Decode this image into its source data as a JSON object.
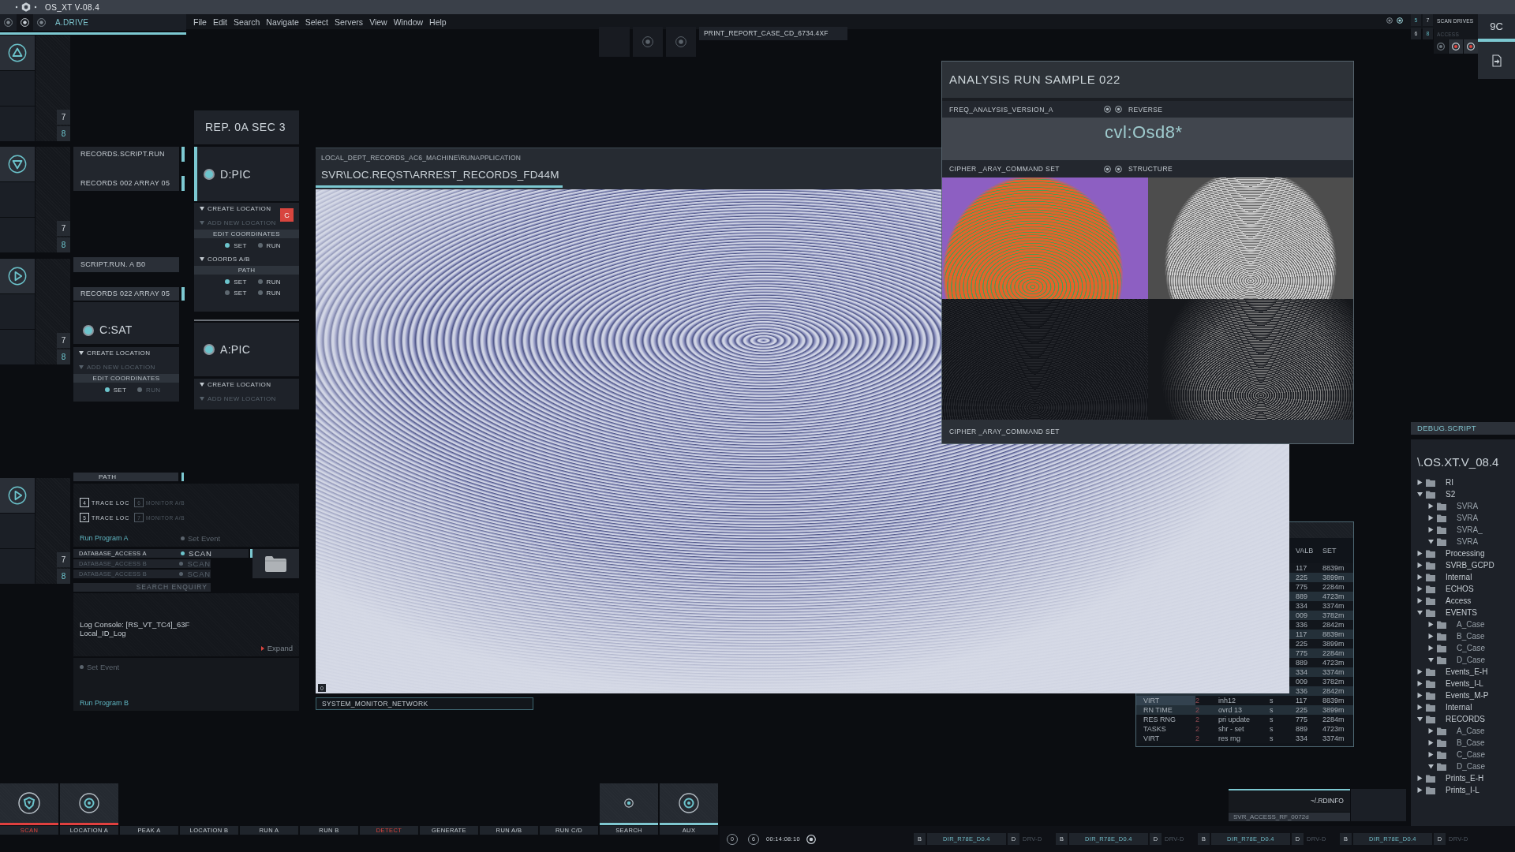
{
  "title_bar": {
    "title": "OS_XT V-08.4"
  },
  "menu_bar": {
    "drive_tab": "A.DRIVE",
    "menus": [
      "File",
      "Edit",
      "Search",
      "Navigate",
      "Select",
      "Servers",
      "View",
      "Window",
      "Help"
    ]
  },
  "top_right": {
    "rows": [
      {
        "numbers": [
          {
            "label": "5",
            "highlighted": true
          },
          {
            "label": "7",
            "highlighted": false
          }
        ],
        "label": "SCAN DRIVES",
        "enabled": true
      },
      {
        "numbers": [
          {
            "label": "6",
            "highlighted": false
          },
          {
            "label": "8",
            "highlighted": true
          }
        ],
        "label": "ACCESS",
        "enabled": false
      }
    ],
    "code": "9C"
  },
  "toolbar": {
    "report": "PRINT_REPORT_CASE_CD_6734.4XF"
  },
  "left_rail": [
    {
      "kind": "up",
      "numbers": [
        {
          "label": "7",
          "highlighted": false
        },
        {
          "label": "8",
          "highlighted": true
        }
      ]
    },
    {
      "kind": "down",
      "numbers": [
        {
          "label": "7",
          "highlighted": false
        },
        {
          "label": "8",
          "highlighted": true
        }
      ]
    },
    {
      "kind": "play",
      "numbers": [
        {
          "label": "7",
          "highlighted": false
        },
        {
          "label": "8",
          "highlighted": true
        }
      ]
    },
    {
      "kind": "play",
      "numbers": [
        {
          "label": "7",
          "highlighted": false
        },
        {
          "label": "8",
          "highlighted": true
        }
      ]
    }
  ],
  "column_a": {
    "scripts": [
      {
        "label": "RECORDS.SCRIPT.RUN",
        "active": true
      },
      {
        "label": "RECORDS 002 ARRAY 05",
        "active": true
      }
    ],
    "tags": [
      {
        "label": "SCRIPT.RUN. A B0",
        "active": false
      },
      {
        "label": "RECORDS 022 ARRAY 05",
        "active": true
      }
    ],
    "drive": {
      "name": "C:SAT",
      "active": false,
      "sections": [
        {
          "kind": "expander",
          "label": "CREATE LOCATION",
          "enabled": true
        },
        {
          "kind": "expander",
          "label": "ADD NEW LOCATION",
          "enabled": false
        },
        {
          "kind": "header",
          "label": "EDIT COORDINATES"
        },
        {
          "kind": "options",
          "options": [
            {
              "label": "SET",
              "on": true,
              "enabled": true
            },
            {
              "label": "RUN",
              "on": false,
              "enabled": false
            }
          ]
        }
      ]
    }
  },
  "column_b": {
    "section_title": "REP. 0A SEC 3",
    "drives": [
      {
        "name": "D:PIC",
        "active": true,
        "sections": [
          {
            "kind": "expander",
            "label": "CREATE LOCATION",
            "enabled": true,
            "tag": "C"
          },
          {
            "kind": "expander",
            "label": "ADD NEW LOCATION",
            "enabled": false
          },
          {
            "kind": "header",
            "label": "EDIT COORDINATES"
          },
          {
            "kind": "options",
            "options": [
              {
                "label": "SET",
                "on": true,
                "enabled": true
              },
              {
                "label": "RUN",
                "on": false,
                "enabled": true
              }
            ]
          },
          {
            "kind": "expander",
            "label": "COORDS A/B",
            "enabled": true
          },
          {
            "kind": "header",
            "label": "PATH"
          },
          {
            "kind": "options",
            "options": [
              {
                "label": "SET",
                "on": true,
                "enabled": true
              },
              {
                "label": "RUN",
                "on": false,
                "enabled": true
              }
            ]
          },
          {
            "kind": "options",
            "options": [
              {
                "label": "SET",
                "on": false,
                "enabled": true
              },
              {
                "label": "RUN",
                "on": false,
                "enabled": true
              }
            ]
          }
        ]
      },
      {
        "name": "A:PIC",
        "active": false,
        "sections": [
          {
            "kind": "expander",
            "label": "CREATE LOCATION",
            "enabled": true
          },
          {
            "kind": "expander",
            "label": "ADD NEW LOCATION",
            "enabled": false
          }
        ]
      }
    ]
  },
  "path_panel": {
    "title": "PATH",
    "active": true,
    "traces": [
      {
        "number": "4",
        "label": "TRACE LOC",
        "enabled": true
      },
      {
        "number": "6",
        "label": "MONITOR A/B",
        "enabled": false
      },
      {
        "number": "5",
        "label": "TRACE LOC",
        "enabled": true
      },
      {
        "number": "7",
        "label": "MONITOR A/B",
        "enabled": false
      }
    ],
    "program": "Run Program A",
    "event": {
      "label": "Set Event",
      "on": false
    }
  },
  "databases": [
    {
      "name": "DATABASE_ACCESS A",
      "action": "SCAN",
      "enabled": true,
      "active": true
    },
    {
      "name": "DATABASE_ACCESS B",
      "action": "SCAN",
      "enabled": false,
      "active": false
    },
    {
      "name": "DATABASE_ACCESS B",
      "action": "SCAN",
      "enabled": false,
      "active": false
    }
  ],
  "search_enquiry": "SEARCH ENQUIRY",
  "log_console": {
    "lines": [
      "Log Console: [RS_VT_TC4]_63F",
      "Local_ID_Log"
    ],
    "expand": "Expand"
  },
  "event_panel": {
    "event": {
      "label": "Set Event",
      "on": false
    },
    "program": "Run Program B"
  },
  "record_window": {
    "path": "LOCAL_DEPT_RECORDS_AC6_MACHINE\\RUNAPPLICATION",
    "title": "SVR\\LOC.REQST\\ARREST_RECORDS_FD44M",
    "corner_label": "0",
    "status": "SYSTEM_MONITOR_NETWORK"
  },
  "analysis_panel": {
    "title": "ANALYSIS RUN SAMPLE 022",
    "freq": {
      "label": "FREQ_ANALYSIS_VERSION_A",
      "option": "REVERSE"
    },
    "value": "cvl:Osd8*",
    "cipher": {
      "label": "CIPHER _ARAY_COMMAND SET",
      "option": "STRUCTURE"
    },
    "images": [
      {
        "kind": "heatmap"
      },
      {
        "kind": "contour"
      },
      {
        "kind": "boxes"
      },
      {
        "kind": "minutiae"
      }
    ],
    "footer": "CIPHER _ARAY_COMMAND SET"
  },
  "process_table": {
    "headers": [
      "VALB",
      "SET"
    ],
    "rows": [
      {
        "valb": "117",
        "set": "8839m",
        "highlighted": false
      },
      {
        "valb": "225",
        "set": "3899m",
        "highlighted": true
      },
      {
        "valb": "775",
        "set": "2284m",
        "highlighted": false
      },
      {
        "valb": "889",
        "set": "4723m",
        "highlighted": true
      },
      {
        "valb": "334",
        "set": "3374m",
        "highlighted": false
      },
      {
        "valb": "009",
        "set": "3782m",
        "highlighted": true
      },
      {
        "valb": "336",
        "set": "2842m",
        "highlighted": false
      },
      {
        "valb": "117",
        "set": "8839m",
        "highlighted": true
      },
      {
        "valb": "225",
        "set": "3899m",
        "highlighted": false
      },
      {
        "valb": "775",
        "set": "2284m",
        "highlighted": true
      },
      {
        "valb": "889",
        "set": "4723m",
        "highlighted": false
      },
      {
        "valb": "334",
        "set": "3374m",
        "highlighted": true
      },
      {
        "valb": "009",
        "set": "3782m",
        "highlighted": false
      },
      {
        "valb": "336",
        "set": "2842m",
        "highlighted": true
      },
      {
        "column_1": "VIRT",
        "column_2": "2",
        "column_3": "inh12",
        "column_4": "s",
        "valb": "117",
        "set": "8839m",
        "highlighted": false,
        "selected": true
      },
      {
        "column_1": "RN TIME",
        "column_2": "2",
        "column_3": "ovrd 13",
        "column_4": "s",
        "valb": "225",
        "set": "3899m",
        "highlighted": true,
        "selected": false
      },
      {
        "column_1": "RES RNG",
        "column_2": "2",
        "column_3": "pri update",
        "column_4": "s",
        "valb": "775",
        "set": "2284m",
        "highlighted": false,
        "selected": false
      },
      {
        "column_1": "TASKS",
        "column_2": "2",
        "column_3": "shr - set",
        "column_4": "s",
        "valb": "889",
        "set": "4723m",
        "highlighted": false,
        "selected": false
      },
      {
        "column_1": "VIRT",
        "column_2": "2",
        "column_3": "res rng",
        "column_4": "s",
        "valb": "334",
        "set": "3374m",
        "highlighted": false,
        "selected": false
      }
    ]
  },
  "debug_panel": {
    "title": "DEBUG.SCRIPT",
    "root": "\\.OS.XT.V_08.4",
    "tree": [
      {
        "label": "RI",
        "expanded": false
      },
      {
        "label": "S2",
        "expanded": true,
        "children": [
          {
            "label": "SVRA",
            "expanded": false
          },
          {
            "label": "SVRA",
            "expanded": false
          },
          {
            "label": "SVRA_",
            "expanded": false
          },
          {
            "label": "SVRA",
            "expanded": true
          }
        ]
      },
      {
        "label": "Processing",
        "expanded": false
      },
      {
        "label": "SVRB_GCPD",
        "expanded": false
      },
      {
        "label": "Internal",
        "expanded": false
      },
      {
        "label": "ECHOS",
        "expanded": false
      },
      {
        "label": "Access",
        "expanded": false
      },
      {
        "label": "EVENTS",
        "expanded": true,
        "children": [
          {
            "label": "A_Case",
            "expanded": false
          },
          {
            "label": "B_Case",
            "expanded": false
          },
          {
            "label": "C_Case",
            "expanded": false
          },
          {
            "label": "D_Case",
            "expanded": true
          }
        ]
      },
      {
        "label": "Events_E-H",
        "expanded": false
      },
      {
        "label": "Events_I-L",
        "expanded": false
      },
      {
        "label": "Events_M-P",
        "expanded": false
      },
      {
        "label": "Internal",
        "expanded": false
      },
      {
        "label": "RECORDS",
        "expanded": true,
        "children": [
          {
            "label": "A_Case",
            "expanded": false
          },
          {
            "label": "B_Case",
            "expanded": false
          },
          {
            "label": "C_Case",
            "expanded": false
          },
          {
            "label": "D_Case",
            "expanded": true
          }
        ]
      },
      {
        "label": "Prints_E-H",
        "expanded": false
      },
      {
        "label": "Prints_I-L",
        "expanded": false
      }
    ]
  },
  "rdinfo": {
    "path": "~/.RDINFO",
    "access": "SVR_ACCESS_RF_0072d"
  },
  "dock": [
    {
      "label": "SCAN",
      "alert": true,
      "tile": {
        "kind": "shield",
        "color": "#e0403f"
      }
    },
    {
      "label": "LOCATION A",
      "alert": false,
      "tile": {
        "kind": "target",
        "color": "#e0403f"
      }
    },
    {
      "label": "PEAK A",
      "alert": false
    },
    {
      "label": "LOCATION B",
      "alert": false
    },
    {
      "label": "RUN A",
      "alert": false
    },
    {
      "label": "RUN B",
      "alert": false
    },
    {
      "label": "DETECT",
      "alert": true
    },
    {
      "label": "GENERATE",
      "alert": false
    },
    {
      "label": "RUN A/B",
      "alert": false
    },
    {
      "label": "RUN C/D",
      "alert": false
    },
    {
      "label": "SEARCH",
      "alert": false,
      "tile": {
        "kind": "point",
        "color": "#7fc7d0"
      }
    },
    {
      "label": "AUX",
      "alert": false,
      "tile": {
        "kind": "target",
        "color": "#7fc7d0"
      }
    }
  ],
  "clock": {
    "counters": [
      "0",
      "6"
    ],
    "time": "00:14:08:10"
  },
  "drive_bar": [
    {
      "tag": "B",
      "path": "DIR_R78E_D0.4",
      "drive_tag": "D",
      "drive": "DRV-D"
    },
    {
      "tag": "B",
      "path": "DIR_R78E_D0.4",
      "drive_tag": "D",
      "drive": "DRV-D"
    },
    {
      "tag": "B",
      "path": "DIR_R78E_D0.4",
      "drive_tag": "D",
      "drive": "DRV-D"
    },
    {
      "tag": "B",
      "path": "DIR_R78E_D0.4",
      "drive_tag": "D",
      "drive": "DRV-D"
    }
  ]
}
